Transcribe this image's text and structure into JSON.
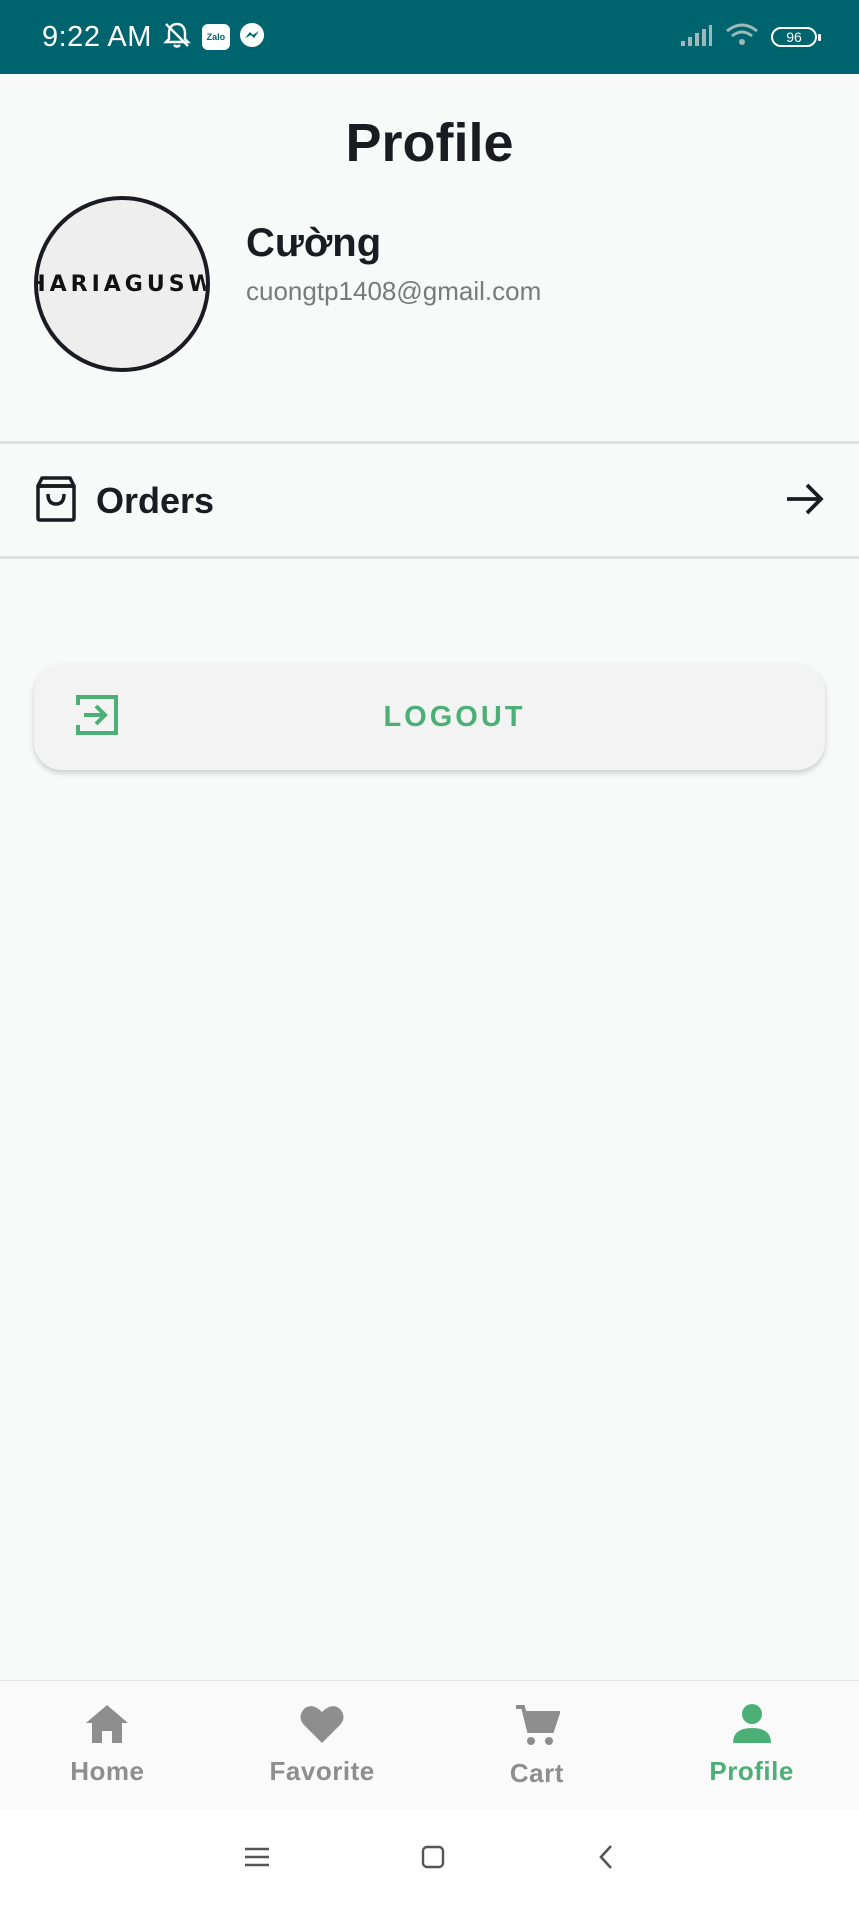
{
  "status_bar": {
    "time": "9:22 AM",
    "zalo_label": "Zalo",
    "battery": "96"
  },
  "page": {
    "title": "Profile"
  },
  "user": {
    "avatar_text": "HARIAGUSW",
    "name": "Cường",
    "email": "cuongtp1408@gmail.com"
  },
  "menu": {
    "orders_label": "Orders",
    "orders_icon": "shopping-bag-icon",
    "arrow_icon": "arrow-right-icon"
  },
  "logout": {
    "label": "LOGOUT",
    "icon": "logout-icon"
  },
  "bottom_nav": {
    "items": [
      {
        "label": "Home",
        "icon": "home-icon"
      },
      {
        "label": "Favorite",
        "icon": "heart-icon"
      },
      {
        "label": "Cart",
        "icon": "cart-icon"
      },
      {
        "label": "Profile",
        "icon": "person-icon",
        "active": true
      }
    ]
  },
  "colors": {
    "status_bar": "#00646f",
    "accent": "#4caf76",
    "text_primary": "#1c1b22",
    "text_muted": "#7a7a7a",
    "nav_inactive": "#8e8e8e"
  }
}
